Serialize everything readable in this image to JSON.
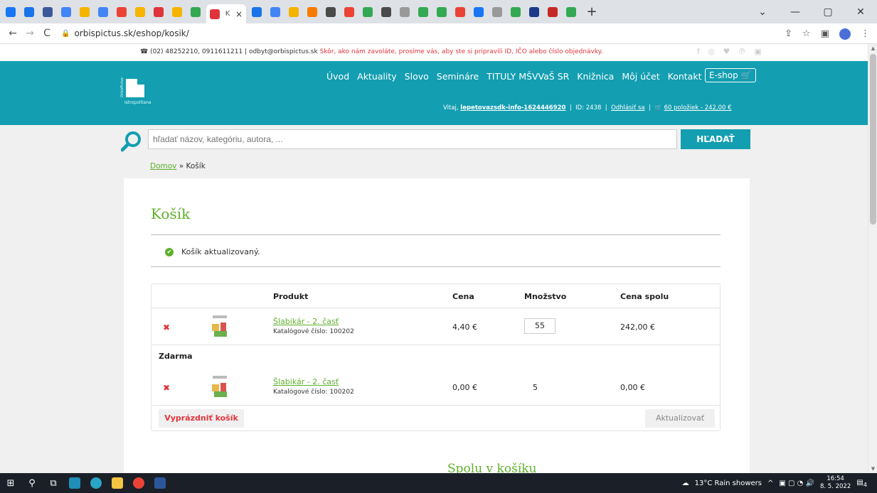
{
  "browser": {
    "tab_k": "K",
    "tab_close": "×",
    "new_tab": "+",
    "url": "orbispictus.sk/eshop/kosik/",
    "controls": {
      "min": "—",
      "max": "▢",
      "close": "✕",
      "down": "⌄"
    },
    "tab_colors": [
      "#1877f2",
      "#1a73e8",
      "#3b5998",
      "#4285f4",
      "#f4b400",
      "#4285f4",
      "#ea4335",
      "#f4b400",
      "#e0343c",
      "#f4b400",
      "#34a853",
      "#1a73e8",
      "#4285f4",
      "#f4b400",
      "#f57c00",
      "#4a4a4a",
      "#ea4335",
      "#34a853",
      "#4a4a4a",
      "#999999",
      "#34a853",
      "#34a853",
      "#ea4335",
      "#1877f2",
      "#999999",
      "#34a853",
      "#1a3a8a",
      "#c62828",
      "#34a853"
    ]
  },
  "topinfo": {
    "contact": "☎ (02) 48252210, 0911611211 | odbyt@orbispictus.sk",
    "warning": "Skôr, ako nám zavoláte, prosíme vás, aby ste si pripravili ID, IČO alebo číslo objednávky.",
    "social": "f ◎ ♥ ℗ ▣"
  },
  "header": {
    "logo_vertical": "OrbisPictus",
    "logo_name": "Istropolitana",
    "menu": [
      "Úvod",
      "Aktuality",
      "Slovo",
      "Semináre",
      "TITULY MŠVVaŠ SR",
      "Knižnica",
      "Môj účet",
      "Kontakt"
    ],
    "eshop": "E-shop",
    "greeting": "Vitaj, ",
    "user": "lepetovazsdk-info-1624446920",
    "id_text": "ID: 2438",
    "logout": "Odhlásiť sa",
    "cart_summary": "60 položiek - 242,00 €"
  },
  "search": {
    "placeholder": "hľadať názov, kategóriu, autora, ...",
    "button": "HĽADAŤ"
  },
  "breadcrumb": {
    "home": "Domov",
    "sep": "»",
    "current": "Košík"
  },
  "cart": {
    "title": "Košík",
    "notice": "Košík aktualizovaný.",
    "headers": {
      "product": "Produkt",
      "price": "Cena",
      "qty": "Množstvo",
      "total": "Cena spolu"
    },
    "items": [
      {
        "name": "Šlabikár - 2. časť",
        "kat_label": "Katalógové číslo:",
        "kat": "100202",
        "price": "4,40 €",
        "qty": "55",
        "total": "242,00 €"
      }
    ],
    "free_section": "Zdarma",
    "free_items": [
      {
        "name": "Šlabikár - 2. časť",
        "kat_label": "Katalógové číslo:",
        "kat": "100202",
        "price": "0,00 €",
        "qty": "5",
        "total": "0,00 €"
      }
    ],
    "empty_btn": "Vyprázdniť košík",
    "update_btn": "Aktualizovať",
    "summary_title": "Spolu v košíku"
  },
  "taskbar": {
    "weather": "13°C  Rain showers",
    "time": "16:54",
    "date": "8. 5. 2022",
    "notif": "4"
  },
  "colors": {
    "teal": "#139eb1",
    "green": "#5fb02b",
    "red": "#e0343c"
  }
}
